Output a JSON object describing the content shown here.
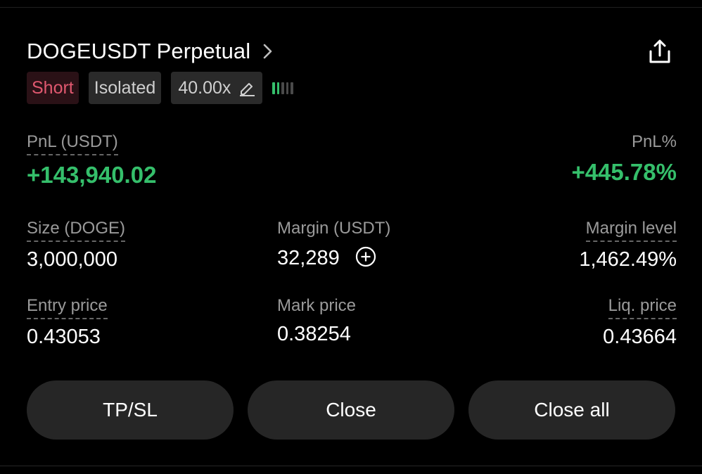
{
  "position": {
    "title": "DOGEUSDT Perpetual",
    "side": "Short",
    "margin_mode": "Isolated",
    "leverage": "40.00x",
    "adl_level": 2
  },
  "pnl": {
    "label": "PnL (USDT)",
    "value": "+143,940.02",
    "pct_label": "PnL%",
    "pct_value": "+445.78%"
  },
  "stats": {
    "size_label": "Size (DOGE)",
    "size_value": "3,000,000",
    "margin_label": "Margin (USDT)",
    "margin_value": "32,289",
    "margin_level_label": "Margin level",
    "margin_level_value": "1,462.49%",
    "entry_label": "Entry price",
    "entry_value": "0.43053",
    "mark_label": "Mark price",
    "mark_value": "0.38254",
    "liq_label": "Liq. price",
    "liq_value": "0.43664"
  },
  "buttons": {
    "tpsl": "TP/SL",
    "close": "Close",
    "close_all": "Close all"
  },
  "colors": {
    "background": "#000000",
    "profit_green": "#35bf6b",
    "short_red": "#e0586f",
    "short_bg": "#2a1116",
    "tag_bg": "#2a2a2a",
    "button_bg": "#262626",
    "muted_text": "#9a9a9a"
  },
  "icons": {
    "title_chevron": "chevron-right-icon",
    "share": "share-icon",
    "leverage_edit": "pencil-icon",
    "margin_add": "plus-circle-icon",
    "adl": "adl-indicator"
  }
}
